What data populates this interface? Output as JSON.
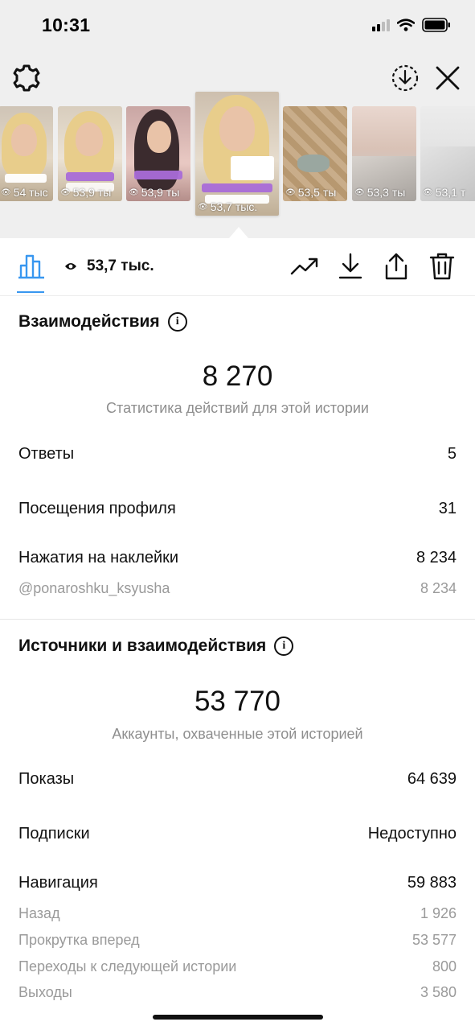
{
  "status_bar": {
    "time": "10:31"
  },
  "colors": {
    "accent": "#3897f0",
    "top_background": "#efefef",
    "muted_text": "#8e8e8e"
  },
  "toolbar": {
    "settings_icon": "gear-icon",
    "download_all_icon": "circle-download-icon",
    "close_icon": "close-icon"
  },
  "thumbnails": [
    {
      "views": "54 тыс"
    },
    {
      "views": "53,9 ты",
      "mention": "@ponaroshku_ksyusha"
    },
    {
      "views": "53,9 ты",
      "mention": "@ponaroshku_ksyusha"
    },
    {
      "views": "53,7 тыс.",
      "mention": "@ponaroshku_ksyusha",
      "current": true
    },
    {
      "views": "53,5 ты"
    },
    {
      "views": "53,3 ты"
    },
    {
      "views": "53,1 т"
    }
  ],
  "actions": {
    "views": "53,7 тыс.",
    "icons": [
      "bar-chart-icon",
      "trend-icon",
      "download-icon",
      "share-icon",
      "trash-icon"
    ]
  },
  "interactions": {
    "title": "Взаимодействия",
    "total": "8 270",
    "caption": "Статистика действий для этой истории",
    "rows": [
      {
        "label": "Ответы",
        "value": "5"
      },
      {
        "label": "Посещения профиля",
        "value": "31"
      },
      {
        "label": "Нажатия на наклейки",
        "value": "8 234"
      }
    ],
    "sub_rows": [
      {
        "label": "@ponaroshku_ksyusha",
        "value": "8 234"
      }
    ]
  },
  "discovery": {
    "title": "Источники и взаимодействия",
    "total": "53 770",
    "caption": "Аккаунты, охваченные этой историей",
    "rows": [
      {
        "label": "Показы",
        "value": "64 639"
      },
      {
        "label": "Подписки",
        "value": "Недоступно"
      },
      {
        "label": "Навигация",
        "value": "59 883"
      }
    ],
    "navigation": [
      {
        "label": "Назад",
        "value": "1 926"
      },
      {
        "label": "Прокрутка вперед",
        "value": "53 577"
      },
      {
        "label": "Переходы к следующей истории",
        "value": "800"
      },
      {
        "label": "Выходы",
        "value": "3 580"
      }
    ]
  }
}
